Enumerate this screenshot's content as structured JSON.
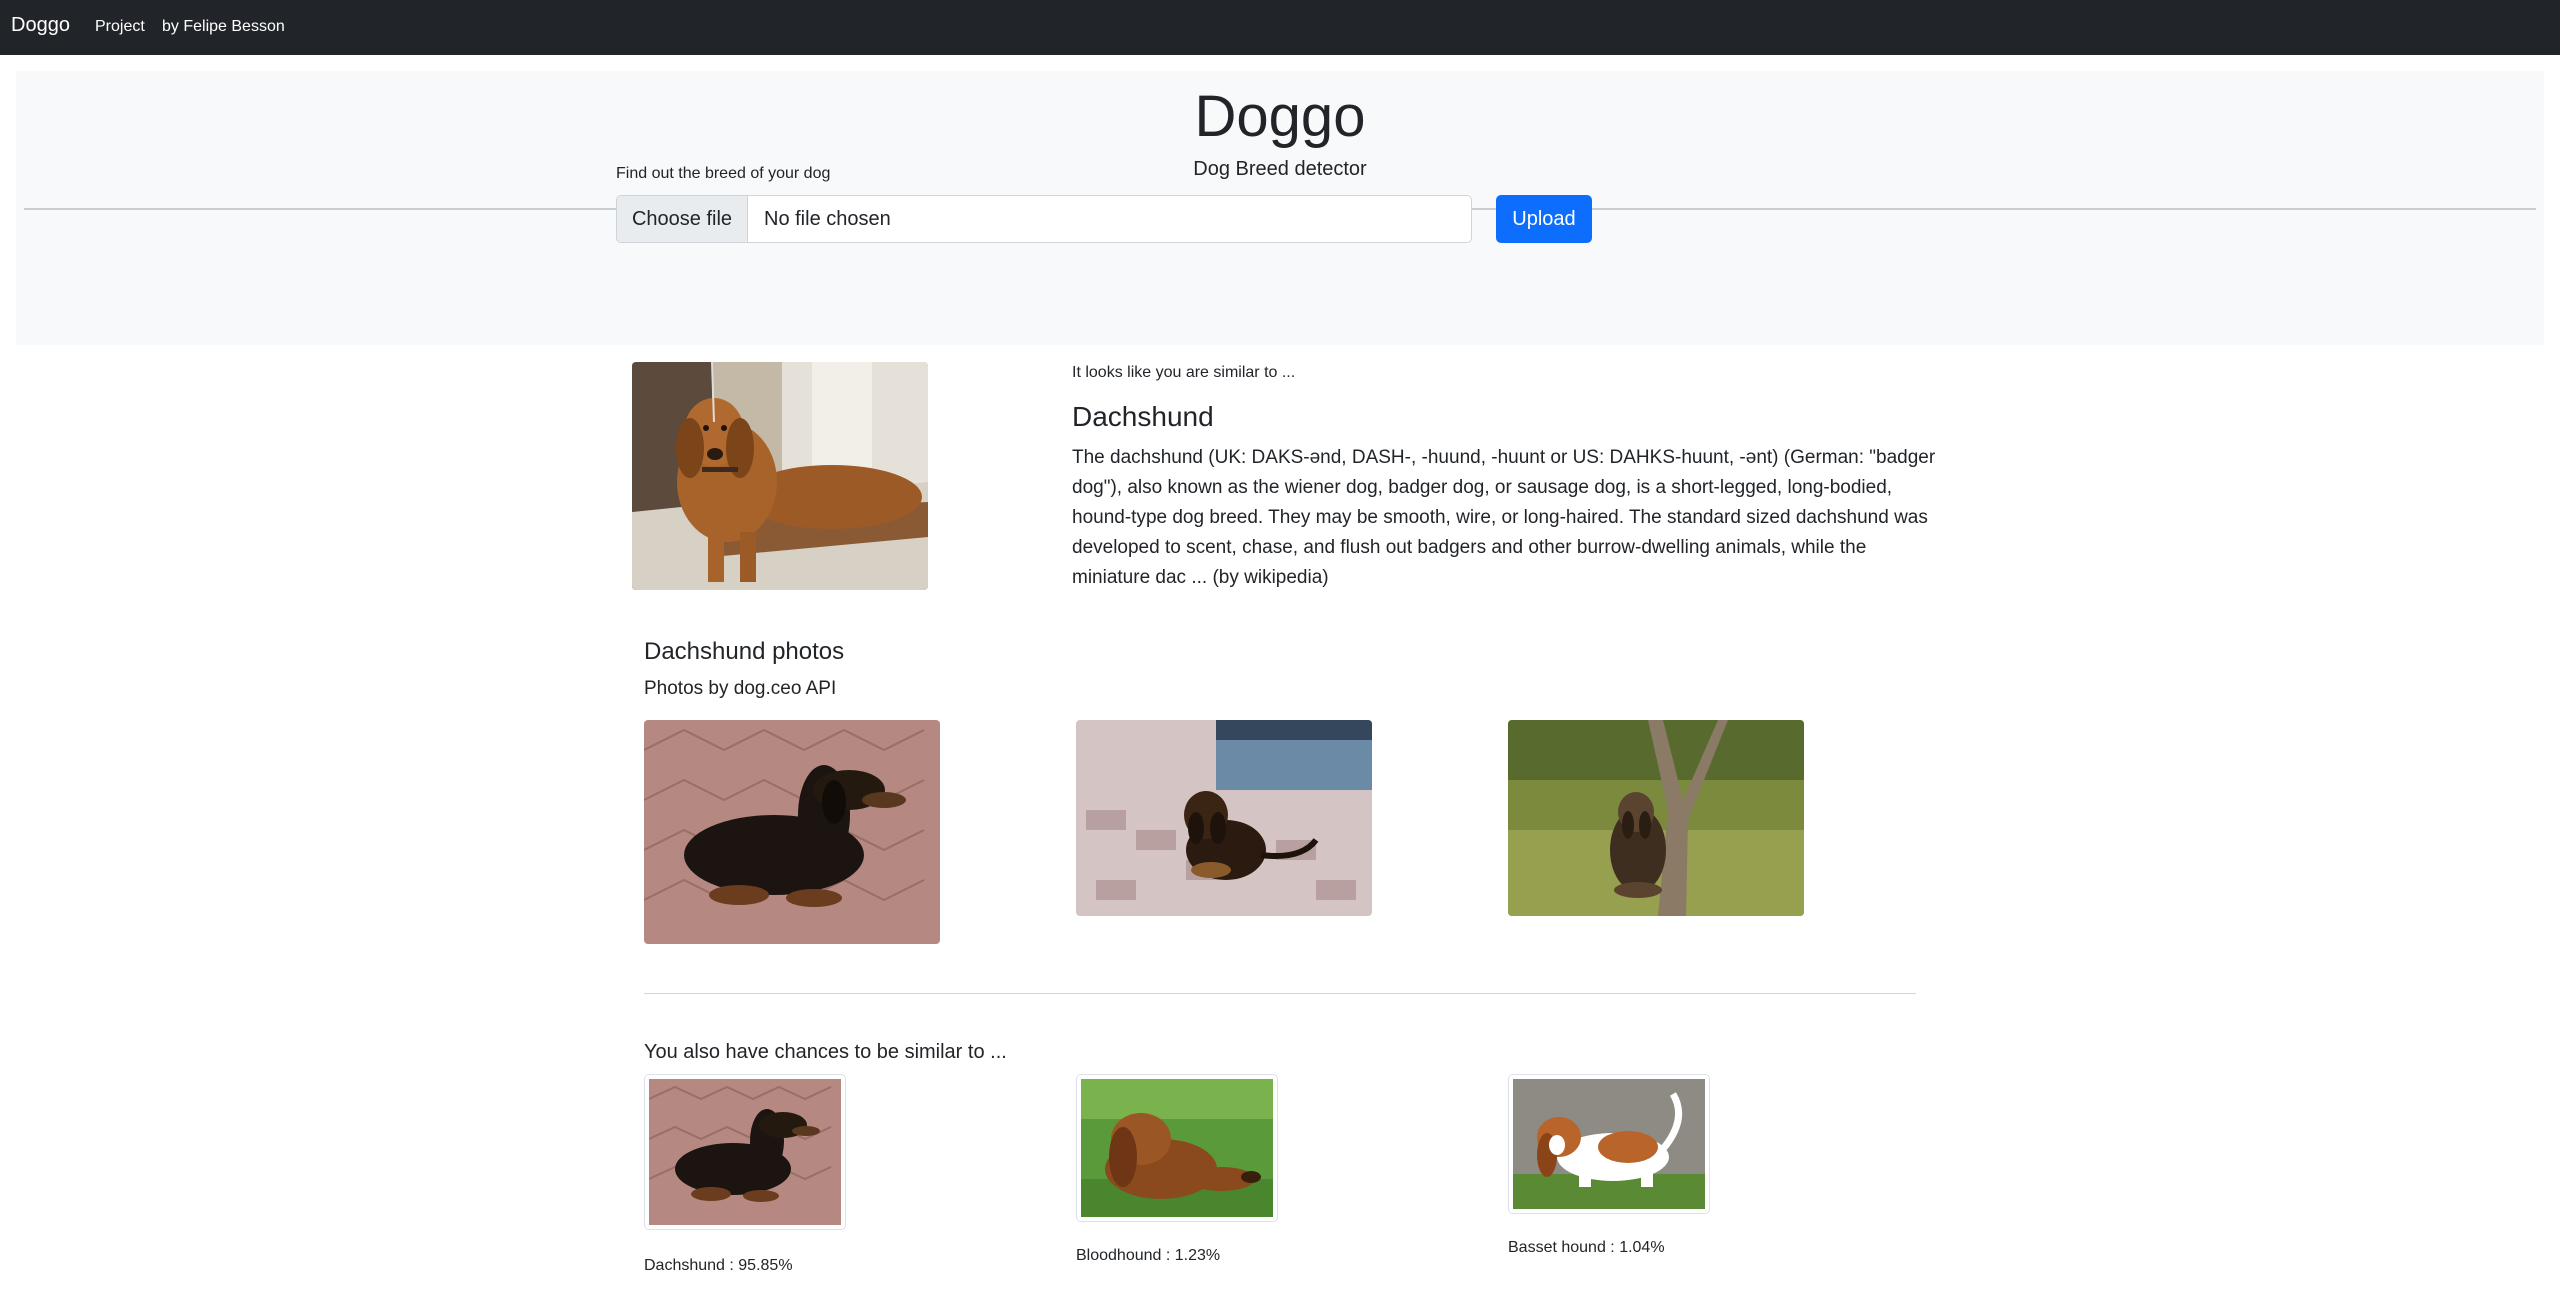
{
  "navbar": {
    "brand": "Doggo",
    "links": [
      "Project",
      "by Felipe Besson"
    ]
  },
  "hero": {
    "title": "Doggo",
    "subtitle": "Dog Breed detector"
  },
  "upload": {
    "label": "Find out the breed of your dog",
    "choose_file_label": "Choose file",
    "file_status": "No file chosen",
    "upload_button": "Upload"
  },
  "result": {
    "intro": "It looks like you are similar to ...",
    "breed": "Dachshund",
    "description": "The dachshund (UK: DAKS-ənd, DASH-, -huund, -huunt or US: DAHKS-huunt, -ənt) (German: \"badger dog\"), also known as the wiener dog, badger dog, or sausage dog, is a short-legged, long-bodied, hound-type dog breed. They may be smooth, wire, or long-haired. The standard sized dachshund was developed to scent, chase, and flush out badgers and other burrow-dwelling animals, while the miniature dac ... (by wikipedia)"
  },
  "photos": {
    "title": "Dachshund photos",
    "subtitle": "Photos by dog.ceo API"
  },
  "chances": {
    "title": "You also have chances to be similar to ...",
    "items": [
      {
        "label": "Dachshund : 95.85%",
        "value": 95.85
      },
      {
        "label": "Bloodhound : 1.23%",
        "value": 1.23
      },
      {
        "label": "Basset hound : 1.04%",
        "value": 1.04
      }
    ]
  }
}
